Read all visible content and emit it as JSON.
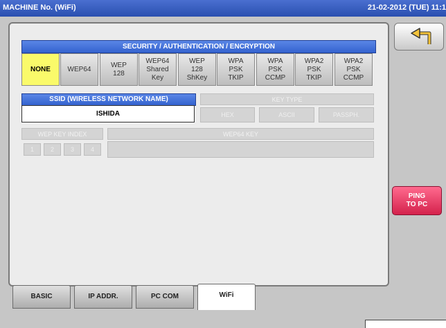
{
  "titlebar": {
    "title": "MACHINE No. (WiFi)",
    "datetime": "21-02-2012 (TUE) 11:1"
  },
  "security": {
    "header": "SECURITY / AUTHENTICATION / ENCRYPTION",
    "options": [
      "NONE",
      "WEP64",
      "WEP\n128",
      "WEP64\nShared\nKey",
      "WEP\n128\nShKey",
      "WPA\nPSK\nTKIP",
      "WPA\nPSK\nCCMP",
      "WPA2\nPSK\nTKIP",
      "WPA2\nPSK\nCCMP"
    ],
    "selected": "NONE"
  },
  "ssid": {
    "header": "SSID (WIRELESS NETWORK NAME)",
    "value": "ISHIDA"
  },
  "key_type": {
    "header": "KEY TYPE",
    "options": [
      "HEX",
      "ASCII",
      "PASSPH."
    ]
  },
  "wep_index": {
    "header": "WEP KEY INDEX",
    "options": [
      "1",
      "2",
      "3",
      "4"
    ]
  },
  "wep_key": {
    "header": "WEP64 KEY"
  },
  "tabs": [
    "BASIC",
    "IP ADDR.",
    "PC COM",
    "WiFi"
  ],
  "active_tab": "WiFi",
  "buttons": {
    "ping": "PING\nTO PC"
  },
  "colors": {
    "header_blue": "#3463cf",
    "selected_yellow": "#fafa6a",
    "ping_red": "#d4224c"
  }
}
